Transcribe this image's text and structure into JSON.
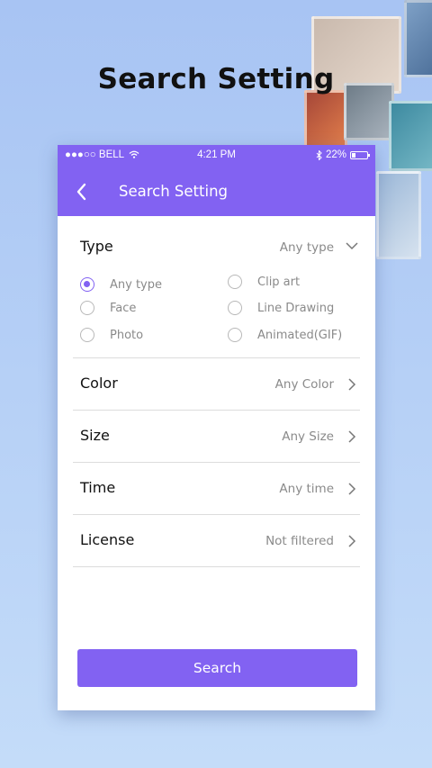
{
  "headline": "Search Setting",
  "status_bar": {
    "carrier": "●●●○○ BELL",
    "time": "4:21 PM",
    "battery": "22%"
  },
  "nav": {
    "back_icon": "chevron-left-icon",
    "title": "Search Setting"
  },
  "type": {
    "label": "Type",
    "value": "Any type",
    "options": [
      {
        "label": "Any type",
        "selected": true
      },
      {
        "label": "Clip art",
        "selected": false
      },
      {
        "label": "Face",
        "selected": false
      },
      {
        "label": "Line Drawing",
        "selected": false
      },
      {
        "label": "Photo",
        "selected": false
      },
      {
        "label": "Animated(GIF)",
        "selected": false
      }
    ]
  },
  "rows": [
    {
      "label": "Color",
      "value": "Any Color"
    },
    {
      "label": "Size",
      "value": "Any Size"
    },
    {
      "label": "Time",
      "value": "Any time"
    },
    {
      "label": "License",
      "value": "Not filtered"
    }
  ],
  "search_button": "Search",
  "colors": {
    "accent": "#8262f2",
    "background": "#b6d0f6"
  }
}
